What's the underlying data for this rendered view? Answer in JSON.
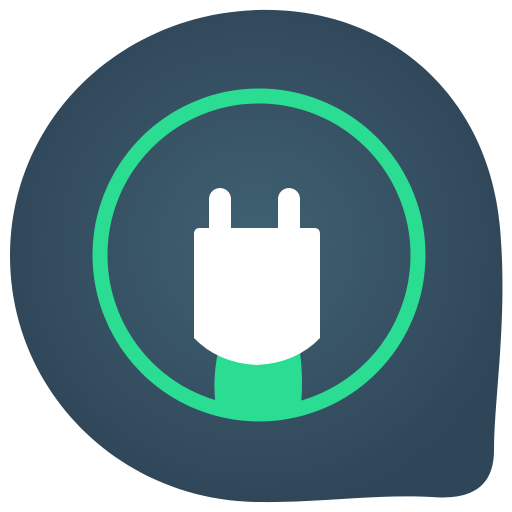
{
  "app_icon": {
    "icon_name": "plug-icon",
    "colors": {
      "background": "#ffffff",
      "blob_light": "#3f6272",
      "blob_dark": "#2f4558",
      "ring": "#2bdc93",
      "plug": "#ffffff",
      "cable": "#2bdc93"
    }
  }
}
